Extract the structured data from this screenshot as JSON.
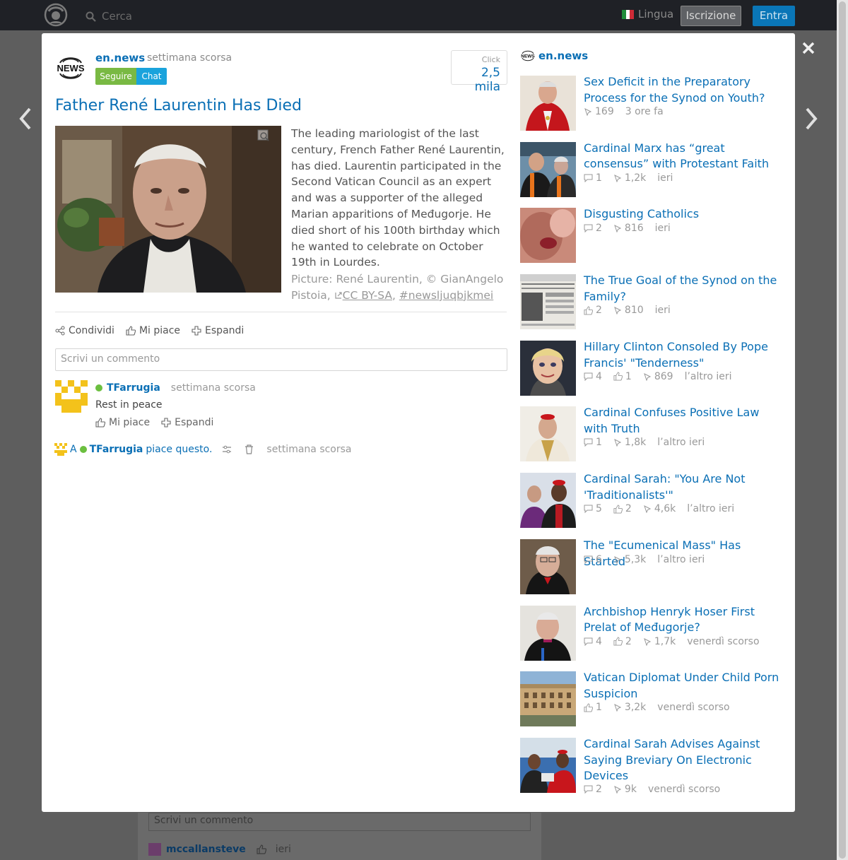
{
  "topbar": {
    "search_placeholder": "Cerca",
    "language_label": "Lingua",
    "register_label": "Iscrizione",
    "login_label": "Entra"
  },
  "article": {
    "source_name": "en.news",
    "source_time": "settimana scorsa",
    "follow_label": "Seguire",
    "chat_label": "Chat",
    "click_label": "Click",
    "click_count": "2,5 mila",
    "title": "Father René Laurentin Has Died",
    "body": "The leading mariologist of the last century, French Father René Laurentin, has died. Laurentin participated in the Second Vatican Council as an expert and was a supporter of the alleged Marian apparitions of Međugorje. He died short of his 100th birthday which he wanted to celebrate on October 19th in Lourdes.",
    "caption_prefix": "Picture: René Laurentin, © GianAngelo Pistoia,",
    "caption_license": "CC BY-SA",
    "caption_tag": "#newsljuqbjkmei",
    "share_label": "Condividi",
    "like_label": "Mi piace",
    "expand_label": "Espandi",
    "comment_placeholder": "Scrivi un commento"
  },
  "comment": {
    "user": "TFarrugia",
    "time": "settimana scorsa",
    "text": "Rest in peace",
    "like_label": "Mi piace",
    "expand_label": "Espandi"
  },
  "likes_line": {
    "prefix": "A",
    "user": "TFarrugia",
    "suffix": "piace questo.",
    "time": "settimana scorsa"
  },
  "sidebar": {
    "source_name": "en.news",
    "items": [
      {
        "title": "Sex Deficit in the Preparatory Process for the Synod on Youth?",
        "comments": "",
        "likes": "",
        "views": "169",
        "time": "3 ore fa"
      },
      {
        "title": "Cardinal Marx has “great consensus” with Protestant Faith",
        "comments": "1",
        "likes": "",
        "views": "1,2k",
        "time": "ieri"
      },
      {
        "title": "Disgusting Catholics",
        "comments": "2",
        "likes": "",
        "views": "816",
        "time": "ieri"
      },
      {
        "title": "The True Goal of the Synod on the Family?",
        "comments": "",
        "likes": "2",
        "views": "810",
        "time": "ieri"
      },
      {
        "title": "Hillary Clinton Consoled By Pope Francis' \"Tenderness\"",
        "comments": "4",
        "likes": "1",
        "views": "869",
        "time": "l’altro ieri"
      },
      {
        "title": "Cardinal Confuses Positive Law with Truth",
        "comments": "1",
        "likes": "",
        "views": "1,8k",
        "time": "l’altro ieri"
      },
      {
        "title": "Cardinal Sarah: \"You Are Not 'Traditionalists'\"",
        "comments": "5",
        "likes": "2",
        "views": "4,6k",
        "time": "l’altro ieri"
      },
      {
        "title": "The \"Ecumenical Mass\" Has Started",
        "comments": "6",
        "likes": "",
        "views": "5,3k",
        "time": "l’altro ieri"
      },
      {
        "title": "Archbishop Henryk Hoser First Prelat of Međugorje?",
        "comments": "4",
        "likes": "2",
        "views": "1,7k",
        "time": "venerdì scorso"
      },
      {
        "title": "Vatican Diplomat Under Child Porn Suspicion",
        "comments": "",
        "likes": "1",
        "views": "3,2k",
        "time": "venerdì scorso"
      },
      {
        "title": "Cardinal Sarah Advises Against Saying Breviary On Electronic Devices",
        "comments": "2",
        "likes": "",
        "views": "9k",
        "time": "venerdì scorso"
      }
    ]
  },
  "background": {
    "comment_placeholder": "Scrivi un commento",
    "user": "mccallansteve",
    "time": "ieri"
  },
  "colors": {
    "accent": "#0a6fb5",
    "follow": "#79b943",
    "chat": "#1aa3dc",
    "topbar": "#1f2126",
    "online": "#6bbf3f"
  }
}
